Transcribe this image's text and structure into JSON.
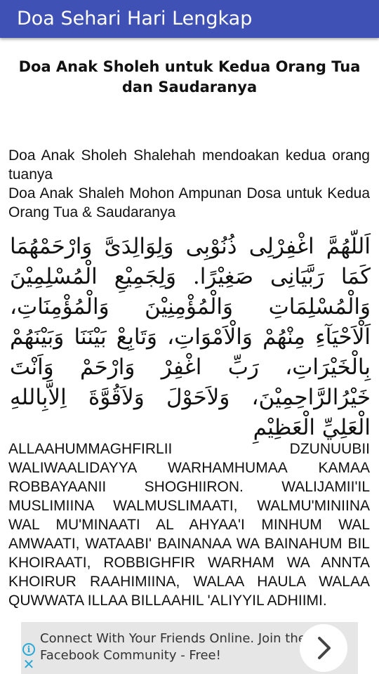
{
  "app_bar": {
    "title": "Doa Sehari Hari Lengkap"
  },
  "article": {
    "title": "Doa Anak Sholeh untuk Kedua Orang Tua dan Saudaranya",
    "intro_lines": [
      "Doa Anak Sholeh Shalehah mendoakan kedua orang tuanya",
      "Doa Anak Shaleh Mohon Ampunan Dosa untuk Kedua Orang Tua & Saudaranya"
    ],
    "arabic": "اَللّهُمَّ اغْفِرْلِى ذُنُوْبِى وَلِوَالِدَىَّ وَارْحَمْهُمَا كَمَا رَبَّيَانِى صَغِيْرًا. وَلِجَمِيْعِ الْمُسْلِمِيْنَ وَالْمُسْلِمَاتِ وَالْمُؤْمِنِيْنَ وَالْمُؤْمِنَاتِ، اَلْاَحْيَآءِ مِنْهُمْ وَالْاَمْوَاتِ، وَتَابِعْ بَيْنَنَا وَبَيْنَهُمْ بِالْخَيْرَاتِ، رَبِّ اغْفِرْ وَارْحَمْ وَاَنْتَ خَيْرُالرَّاحِمِيْنَ، وَلاَحَوْلَ وَلاَقُوَّةَ اِلاَّبِاللهِ الْعَلِيِّ الْعَظِيْمِ",
    "latin": "ALLAAHUMMAGHFIRLII DZUNUUBII WALIWAALIDAYYA WARHAMHUMAA KAMAA ROBBAYAANII SHOGHIIRON. WALIJAMII'IL MUSLIMIINA WALMUSLIMAATI, WALMU'MINIINA WAL MU'MINAATI AL AHYAA'I MINHUM WAL AMWAATI, WATAABI' BAINANAA WA BAINAHUM BIL KHOIRAATI, ROBBIGHFIR WARHAM WA ANNTA KHOIRUR RAAHIMIINA, WALAA HAULA WALAA QUWWATA ILLAA BILLAAHIL 'ALIYYIL ADHIIMI."
  },
  "ad_banner": {
    "text": "Connect With Your Friends Online. Join the Facebook Community - Free!",
    "info_glyph": "i",
    "close_glyph": "✕",
    "accent_color": "#2aa9d6",
    "background_color": "#e6e6e6"
  },
  "theme": {
    "primary": "#3f51b5",
    "on_primary": "#ffffff"
  }
}
